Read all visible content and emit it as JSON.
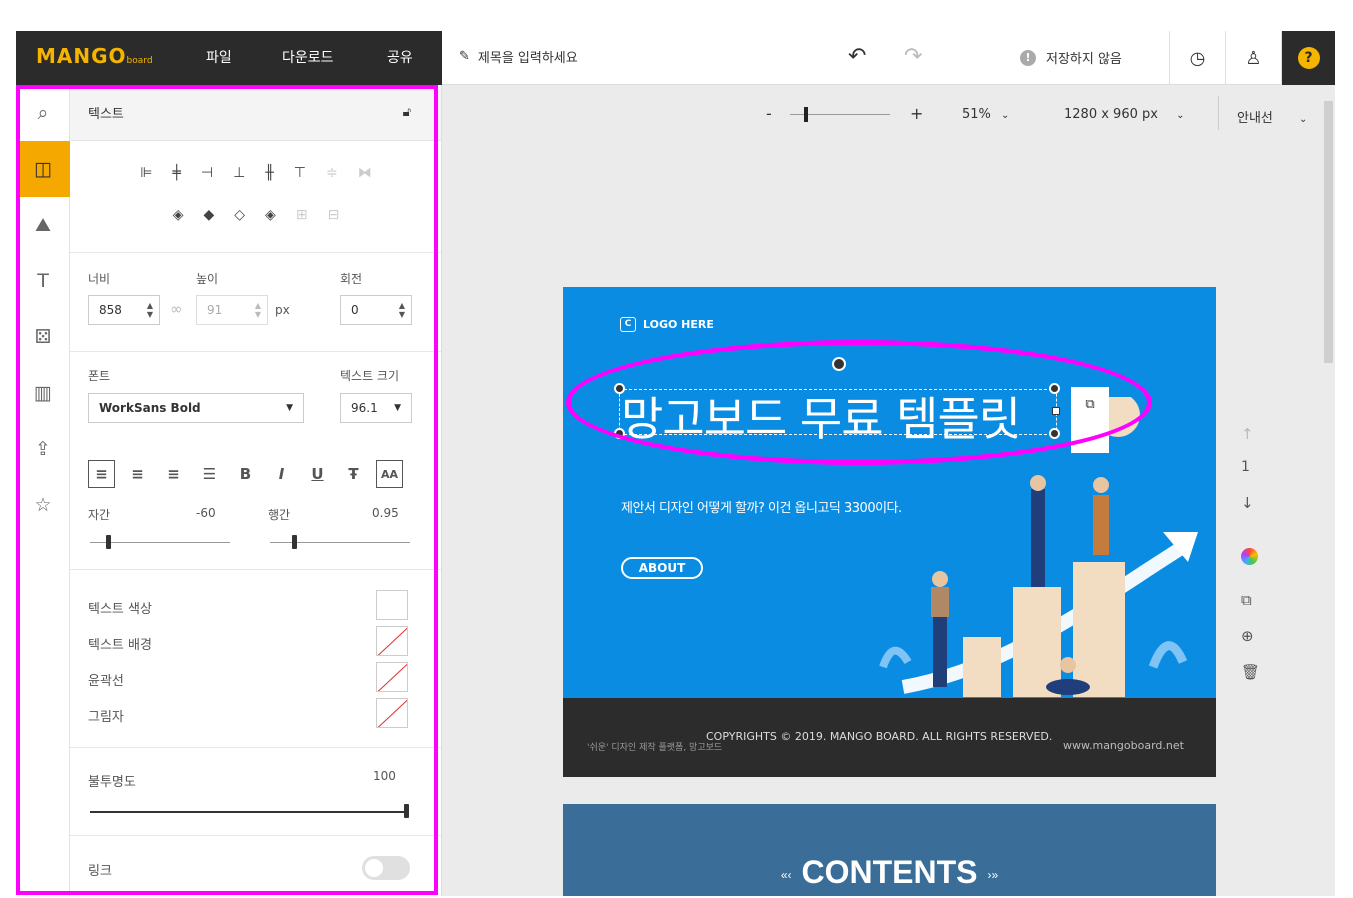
{
  "topbar": {
    "logo": "MANGO",
    "logo_suffix": "board",
    "menu": [
      "파일",
      "다운로드",
      "공유"
    ],
    "title_placeholder": "제목을 입력하세요",
    "save_status": "저장하지 않음",
    "help": "?"
  },
  "panel": {
    "header": "텍스트",
    "width_label": "너비",
    "height_label": "높이",
    "rotation_label": "회전",
    "width_value": "858",
    "height_value": "91",
    "unit": "px",
    "rotation_value": "0",
    "font_label": "폰트",
    "font_value": "WorkSans Bold",
    "size_label": "텍스트 크기",
    "size_value": "96.1",
    "format_buttons": [
      "B",
      "I",
      "U",
      "AA"
    ],
    "letter_spacing_label": "자간",
    "letter_spacing_value": "-60",
    "line_height_label": "행간",
    "line_height_value": "0.95",
    "text_color_label": "텍스트 색상",
    "text_bg_label": "텍스트 배경",
    "outline_label": "윤곽선",
    "shadow_label": "그림자",
    "opacity_label": "불투명도",
    "opacity_value": "100",
    "link_label": "링크"
  },
  "canvas_toolbar": {
    "zoom_minus": "-",
    "zoom_plus": "+",
    "zoom_level": "51%",
    "page_size": "1280 x 960 px",
    "guides": "안내선"
  },
  "design": {
    "logo_text": "LOGO HERE",
    "headline": "망고보드 무료 템플릿",
    "subtext": "제안서 디자인 어떻게 할까? 이건 옵니고딕 3300이다.",
    "about": "ABOUT",
    "copyright": "COPYRIGHTS © 2019. MANGO BOARD. ALL RIGHTS RESERVED.",
    "tagline": "'쉬운' 디자인 제작 플랫폼, 망고보드",
    "site": "www.mangoboard.net",
    "contents_title": "CONTENTS",
    "page_number": "1"
  },
  "colors": {
    "accent": "#f5a800",
    "highlight": "#ff00ff",
    "design_blue": "#0a8ce3"
  }
}
